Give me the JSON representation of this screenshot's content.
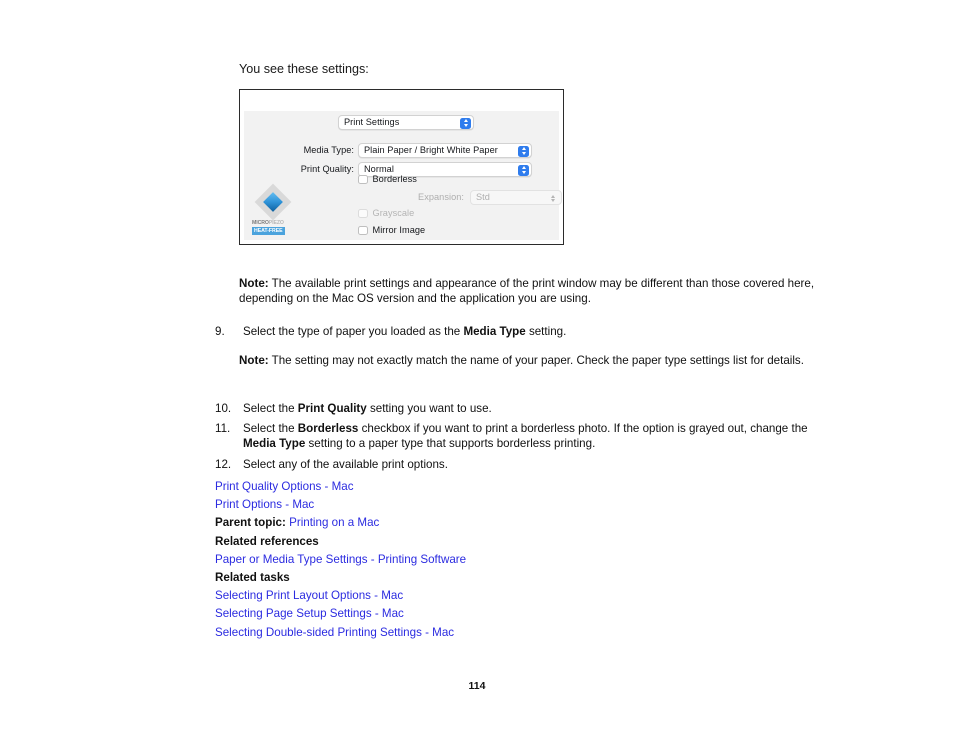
{
  "document": {
    "intro_text": "You see these settings:",
    "page_number": "114"
  },
  "dialog": {
    "pane_popup": {
      "label": "Print Settings",
      "icon": "stepper-updown-icon"
    },
    "media_type": {
      "label": "Media Type:",
      "value": "Plain Paper / Bright White Paper"
    },
    "print_quality": {
      "label": "Print Quality:",
      "value": "Normal"
    },
    "borderless": {
      "label": "Borderless",
      "checked": "false"
    },
    "expansion": {
      "label": "Expansion:",
      "value": "Std",
      "enabled": "false"
    },
    "grayscale": {
      "label": "Grayscale",
      "checked": "false",
      "enabled": "false"
    },
    "mirror_image": {
      "label": "Mirror Image",
      "checked": "false"
    },
    "logo": {
      "line1_a": "MICRO",
      "line1_b": "PIEZO",
      "line2": "HEAT-FREE"
    }
  },
  "notes": {
    "note_label": "Note:",
    "note_1": " The available print settings and appearance of the print window may be different than those covered here, depending on the Mac OS version and the application you are using.",
    "note_2": " The setting may not exactly match the name of your paper. Check the paper type settings list for details."
  },
  "steps": {
    "item_9": {
      "number": "9.",
      "pre": "Select the type of paper you loaded as the ",
      "bold": "Media Type",
      "post": " setting."
    },
    "item_10": {
      "number": "10.",
      "pre": "Select the ",
      "bold": "Print Quality",
      "post": " setting you want to use."
    },
    "item_11": {
      "number": "11.",
      "pre": "Select the ",
      "bold": "Borderless",
      "mid": " checkbox if you want to print a borderless photo. If the option is grayed out, change the ",
      "bold2": "Media Type",
      "post": " setting to a paper type that supports borderless printing."
    },
    "item_12": {
      "number": "12.",
      "pre": "Select any of the available print options.",
      "bold": "",
      "post": ""
    }
  },
  "links": {
    "print_quality_options": "Print Quality Options - Mac",
    "print_options": "Print Options - Mac",
    "parent_topic_label": "Parent topic:",
    "parent_topic_link": "Printing on a Mac",
    "related_references_header": "Related references",
    "paper_media_type_settings": "Paper or Media Type Settings - Printing Software",
    "related_tasks_header": "Related tasks",
    "selecting_print_layout": "Selecting Print Layout Options - Mac",
    "selecting_page_setup": "Selecting Page Setup Settings - Mac",
    "selecting_double_sided": "Selecting Double-sided Printing Settings - Mac"
  },
  "colors": {
    "link": "#2b2be0",
    "stepper_blue": "#2f7ced",
    "dialog_bg": "#f2f2f2"
  }
}
